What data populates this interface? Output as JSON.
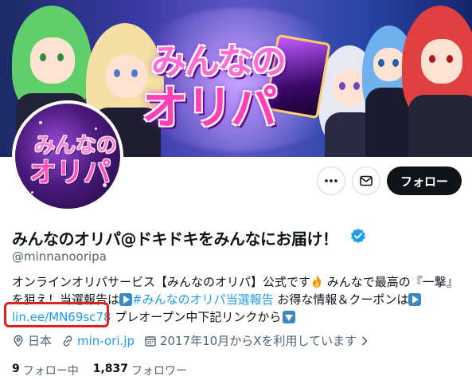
{
  "banner": {
    "title_line1": "みんなの",
    "title_line2": "オリパ"
  },
  "avatar": {
    "line1": "みんなの",
    "line2": "オリパ"
  },
  "actions": {
    "follow_label": "フォロー"
  },
  "profile": {
    "display_name": "みんなのオリパ@ドキドキをみんなにお届け！",
    "handle": "@minnanooripa",
    "bio": {
      "line1_a": "オンラインオリパサービス【みんなのオリパ】公式です",
      "line1_b": " みんなで最高の『一撃』",
      "line2_a": "を狙え！当選報告は",
      "line2_hashtag": "#みんなのオリパ当選報告",
      "line2_b": " お得な情報＆クーポンは",
      "line3_link": "lin.ee/MN69sc78",
      "line3_b": " プレオープン中下記リンクから"
    },
    "location": "日本",
    "website": "min-ori.jp",
    "joined": "2017年10月からXを利用しています"
  },
  "stats": {
    "following_count": "9",
    "following_label": "フォロー中",
    "followers_count": "1,837",
    "followers_label": "フォロワー"
  },
  "colors": {
    "link": "#1d9bf0",
    "verified": "#1d9bf0",
    "follow_button_bg": "#0f1419",
    "highlight_box": "#e0201f"
  },
  "icons": [
    "more-icon",
    "mail-icon",
    "verified-badge-icon",
    "location-icon",
    "link-icon",
    "calendar-icon",
    "chevron-right-icon",
    "fire-emoji-icon",
    "play-button-emoji-icon",
    "down-arrow-emoji-icon"
  ]
}
